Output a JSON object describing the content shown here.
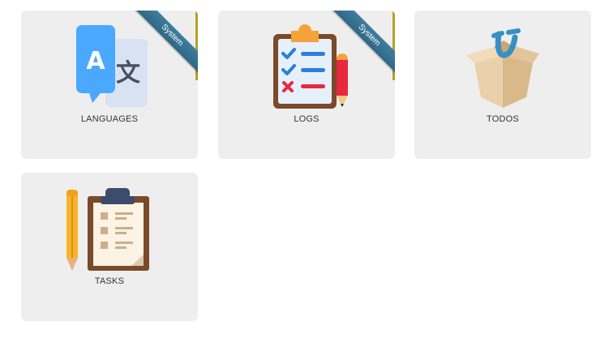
{
  "tiles": [
    {
      "id": "languages",
      "label": "LANGUAGES",
      "ribbon": "System",
      "icon": "translate-icon"
    },
    {
      "id": "logs",
      "label": "LOGS",
      "ribbon": "System",
      "icon": "clipboard-checklist-icon"
    },
    {
      "id": "todos",
      "label": "TODOS",
      "icon": "open-box-icon"
    },
    {
      "id": "tasks",
      "label": "TASKS",
      "icon": "clipboard-pencil-icon"
    }
  ],
  "icon_glyphs": {
    "translate_left": "A",
    "translate_right": "文"
  },
  "colors": {
    "tile_bg": "#eeeeee",
    "ribbon": "#3f7d9e",
    "label": "#333333"
  }
}
